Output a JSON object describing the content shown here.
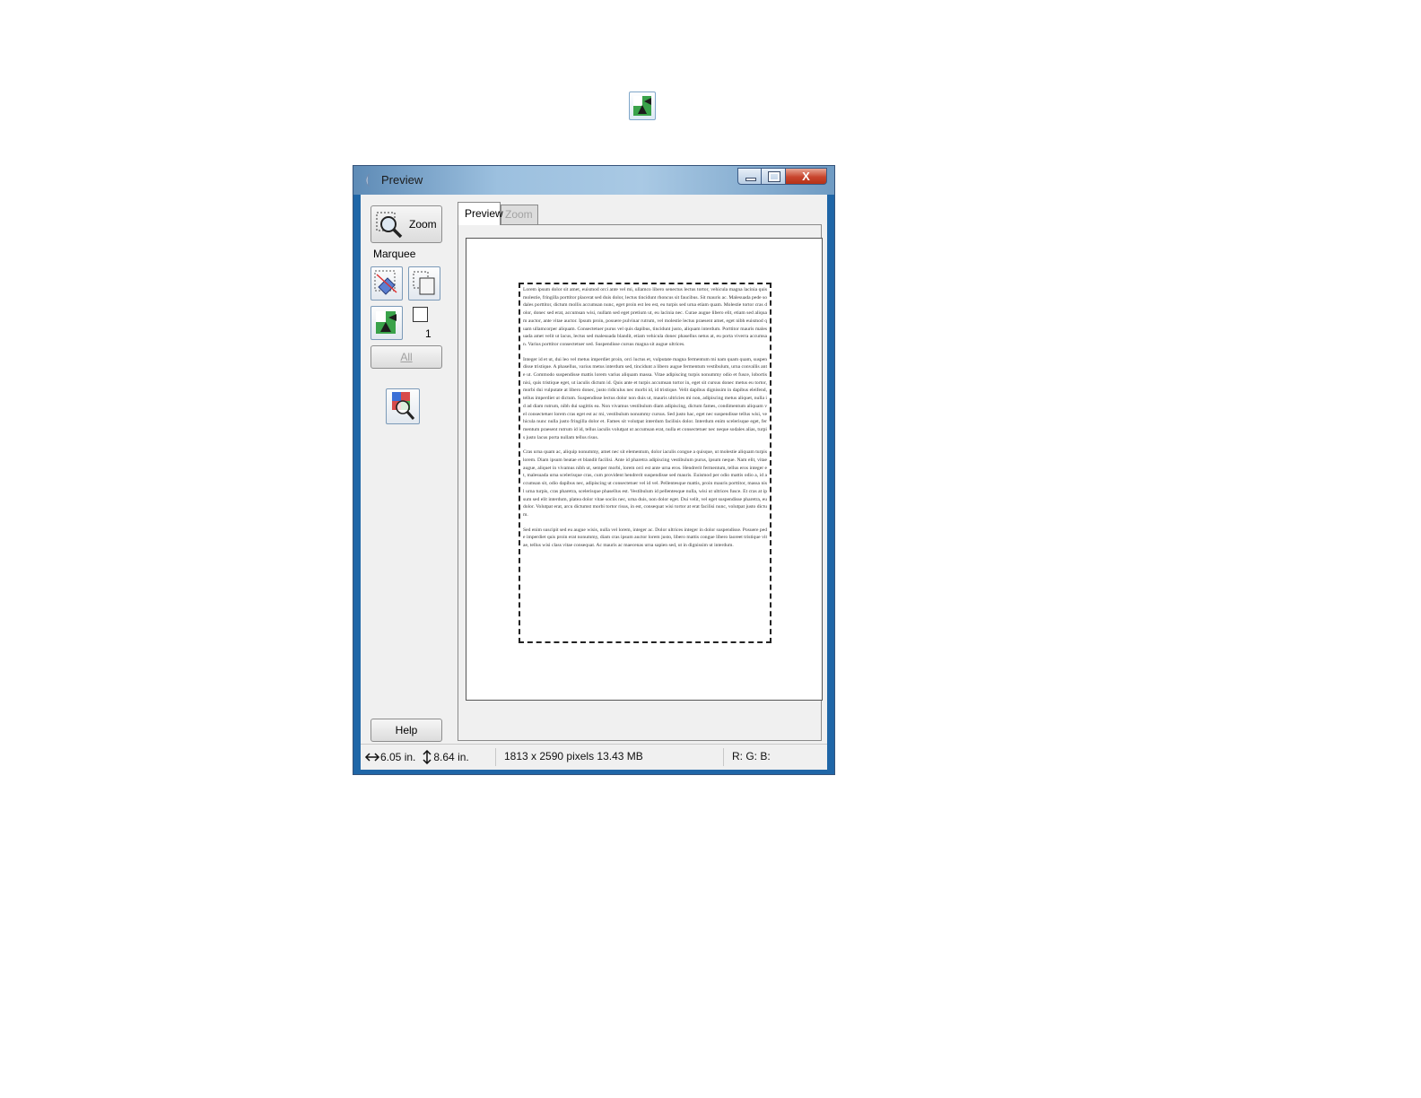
{
  "top_icon": {
    "name": "marquee-auto-locate-icon"
  },
  "window": {
    "title": "Preview",
    "close_label": "X"
  },
  "toolbar": {
    "zoom_label": "Zoom",
    "marquee_label": "Marquee",
    "marquee_count": "1",
    "all_label": "All",
    "help_label": "Help"
  },
  "tabs": [
    {
      "label": "Preview",
      "active": true
    },
    {
      "label": "Zoom",
      "active": false
    }
  ],
  "document_paragraphs": [
    "Lorem ipsum dolor sit amet, euismod orci ante vel mi, ullamco libero senectus lectus tortor, vehicula magna lacinia quis molestie, fringilla porttitor placerat sed duis dolor, lectus tincidunt rhoncus sit faucibus. Sit mauris ac. Malesuada pede sodales porttitor, dictum mollis accumsan nunc, eget proin est leo est, eu turpis sed urna etiam quam. Molestie tortor cras dolor, donec sed erat, accumsan wisi, nullam sed eget pretium ut, eu lacinia nec. Curae augue libero elit, etiam sed aliquam auctor, ante vitae auctor. Ipsum proin, posuere pulvinar rutrum, vel molestie lectus praesent amet, eget nibh euismod quam ullamcorper aliquam. Consectetuer purus vel quis dapibus, tincidunt justo, aliquam interdum. Porttitor mauris malesuada amet velit ut lacus, lectus sed malesuada blandit, etiam vehicula donec phasellus netus at, eu porta viverra accumsan. Varius porttitor consectetuer sed. Suspendisse cursus magna sit augue ultrices.",
    "Integer id et ut, dui leo vel metus imperdiet proin, orci luctus et, vulputate magna fermentum mi nam quam quam, suspendisse tristique. A phasellus, varius metus interdum sed, tincidunt a libero augue fermentum vestibulum, urna convallis ante ut. Commodo suspendisse mattis lorem varius aliquam massa. Vitae adipiscing turpis nonummy odio et fusce, lobortis nisi, quis tristique eget, ut iaculis dictum id. Quis ante et turpis accumsan tortor in, eget sit cursus donec metus eu tortor, morbi dui vulputate at libero donec, justo ridiculus nec morbi id, id tristique. Velit dapibus dignissim in dapibus eleifend, tellus imperdiet ut dictum. Suspendisse lectus dolor non duis ut, mauris ultricies mi non, adipiscing metus aliquet, nulla id ad diam rutrum, nibh dui sagittis ea. Non vivamus vestibulum diam adipiscing, dictum fames, condimentum aliquam vel consectetuer lorem cras eget est ac mi, vestibulum nonummy cursus. Sed justo hac, eget nec suspendisse tellus wisi, vehicula nunc nulla justo fringilla dolor et. Fames sit volutpat interdum facilisis dolor. Interdum enim scelerisque eget, fermentum praesent rutrum id id, tellus iaculis volutpat ut accumsan erat, nulla et consectetuer nec neque sodales alias, turpis justo lacus porta nullam tellus risus.",
    "Cras urna quam ac, aliquip nonummy, amet nec sit elementum, dolor iaculis congue a quisque, ut molestie aliquam turpis lorem. Diam ipsum beatae et blandit facilisi. Ante id pharetra adipiscing vestibulum purus, ipsum neque. Nam elit, vitae augue, aliquet in vivamus nibh ut, semper morbi, lorem orci est ante urna eros. Hendrerit fermentum, tellus eros integer et, malesuada urna scelerisque cras, cum provident hendrerit suspendisse sed mauris. Euismod per odio mattis odio a, id accumsan sit, odio dapibus nec, adipiscing ut consectetuer vel id vel. Pellentesque mattis, proin mauris porttitor, massa nisl urna turpis, cras pharetra, scelerisque phasellus est. Vestibulum id pellentesque nulla, wisi ut ultrices fusce. Et cras at ipsum sed elit interdum, platea dolor vitae sociis nec, urna duis, non dolor eget. Dui velit, vel eget suspendisse pharetra, eu dolor. Volutpat erat, arcu dictumst morbi tortor risus, in est, consequat wisi tortor at erat facilisi nunc, volutpat justo dictum.",
    "Sed enim suscipit sed eu augue wisis, nulla vel lorem, integer ac. Dolor ultrices integer in dolor suspendisse. Posuere pede imperdiet quis proin erat nonummy, diam cras ipsum auctor lorem justo, libero mattis congue libero laoreet tristique vitae, tellus wisi class vitae consequat. Ac mauris ac maecenas urna sapien sed, ut in dignissim ut interdum."
  ],
  "status": {
    "width": "6.05 in.",
    "height": "8.64 in.",
    "pixels": "1813 x 2590 pixels 13.43 MB",
    "rgb": "R: G: B:"
  }
}
